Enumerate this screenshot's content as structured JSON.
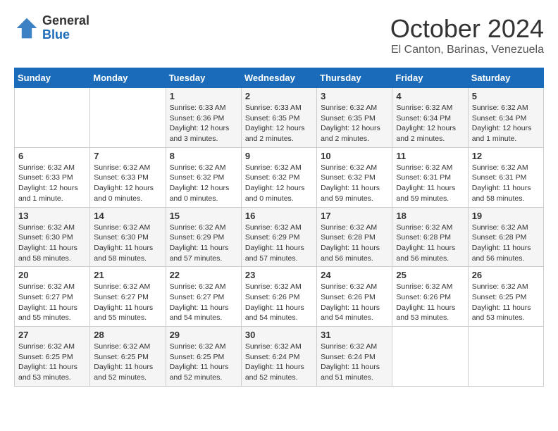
{
  "logo": {
    "general": "General",
    "blue": "Blue"
  },
  "header": {
    "month": "October 2024",
    "location": "El Canton, Barinas, Venezuela"
  },
  "weekdays": [
    "Sunday",
    "Monday",
    "Tuesday",
    "Wednesday",
    "Thursday",
    "Friday",
    "Saturday"
  ],
  "weeks": [
    [
      {
        "day": "",
        "info": ""
      },
      {
        "day": "",
        "info": ""
      },
      {
        "day": "1",
        "info": "Sunrise: 6:33 AM\nSunset: 6:36 PM\nDaylight: 12 hours and 3 minutes."
      },
      {
        "day": "2",
        "info": "Sunrise: 6:33 AM\nSunset: 6:35 PM\nDaylight: 12 hours and 2 minutes."
      },
      {
        "day": "3",
        "info": "Sunrise: 6:32 AM\nSunset: 6:35 PM\nDaylight: 12 hours and 2 minutes."
      },
      {
        "day": "4",
        "info": "Sunrise: 6:32 AM\nSunset: 6:34 PM\nDaylight: 12 hours and 2 minutes."
      },
      {
        "day": "5",
        "info": "Sunrise: 6:32 AM\nSunset: 6:34 PM\nDaylight: 12 hours and 1 minute."
      }
    ],
    [
      {
        "day": "6",
        "info": "Sunrise: 6:32 AM\nSunset: 6:33 PM\nDaylight: 12 hours and 1 minute."
      },
      {
        "day": "7",
        "info": "Sunrise: 6:32 AM\nSunset: 6:33 PM\nDaylight: 12 hours and 0 minutes."
      },
      {
        "day": "8",
        "info": "Sunrise: 6:32 AM\nSunset: 6:32 PM\nDaylight: 12 hours and 0 minutes."
      },
      {
        "day": "9",
        "info": "Sunrise: 6:32 AM\nSunset: 6:32 PM\nDaylight: 12 hours and 0 minutes."
      },
      {
        "day": "10",
        "info": "Sunrise: 6:32 AM\nSunset: 6:32 PM\nDaylight: 11 hours and 59 minutes."
      },
      {
        "day": "11",
        "info": "Sunrise: 6:32 AM\nSunset: 6:31 PM\nDaylight: 11 hours and 59 minutes."
      },
      {
        "day": "12",
        "info": "Sunrise: 6:32 AM\nSunset: 6:31 PM\nDaylight: 11 hours and 58 minutes."
      }
    ],
    [
      {
        "day": "13",
        "info": "Sunrise: 6:32 AM\nSunset: 6:30 PM\nDaylight: 11 hours and 58 minutes."
      },
      {
        "day": "14",
        "info": "Sunrise: 6:32 AM\nSunset: 6:30 PM\nDaylight: 11 hours and 58 minutes."
      },
      {
        "day": "15",
        "info": "Sunrise: 6:32 AM\nSunset: 6:29 PM\nDaylight: 11 hours and 57 minutes."
      },
      {
        "day": "16",
        "info": "Sunrise: 6:32 AM\nSunset: 6:29 PM\nDaylight: 11 hours and 57 minutes."
      },
      {
        "day": "17",
        "info": "Sunrise: 6:32 AM\nSunset: 6:28 PM\nDaylight: 11 hours and 56 minutes."
      },
      {
        "day": "18",
        "info": "Sunrise: 6:32 AM\nSunset: 6:28 PM\nDaylight: 11 hours and 56 minutes."
      },
      {
        "day": "19",
        "info": "Sunrise: 6:32 AM\nSunset: 6:28 PM\nDaylight: 11 hours and 56 minutes."
      }
    ],
    [
      {
        "day": "20",
        "info": "Sunrise: 6:32 AM\nSunset: 6:27 PM\nDaylight: 11 hours and 55 minutes."
      },
      {
        "day": "21",
        "info": "Sunrise: 6:32 AM\nSunset: 6:27 PM\nDaylight: 11 hours and 55 minutes."
      },
      {
        "day": "22",
        "info": "Sunrise: 6:32 AM\nSunset: 6:27 PM\nDaylight: 11 hours and 54 minutes."
      },
      {
        "day": "23",
        "info": "Sunrise: 6:32 AM\nSunset: 6:26 PM\nDaylight: 11 hours and 54 minutes."
      },
      {
        "day": "24",
        "info": "Sunrise: 6:32 AM\nSunset: 6:26 PM\nDaylight: 11 hours and 54 minutes."
      },
      {
        "day": "25",
        "info": "Sunrise: 6:32 AM\nSunset: 6:26 PM\nDaylight: 11 hours and 53 minutes."
      },
      {
        "day": "26",
        "info": "Sunrise: 6:32 AM\nSunset: 6:25 PM\nDaylight: 11 hours and 53 minutes."
      }
    ],
    [
      {
        "day": "27",
        "info": "Sunrise: 6:32 AM\nSunset: 6:25 PM\nDaylight: 11 hours and 53 minutes."
      },
      {
        "day": "28",
        "info": "Sunrise: 6:32 AM\nSunset: 6:25 PM\nDaylight: 11 hours and 52 minutes."
      },
      {
        "day": "29",
        "info": "Sunrise: 6:32 AM\nSunset: 6:25 PM\nDaylight: 11 hours and 52 minutes."
      },
      {
        "day": "30",
        "info": "Sunrise: 6:32 AM\nSunset: 6:24 PM\nDaylight: 11 hours and 52 minutes."
      },
      {
        "day": "31",
        "info": "Sunrise: 6:32 AM\nSunset: 6:24 PM\nDaylight: 11 hours and 51 minutes."
      },
      {
        "day": "",
        "info": ""
      },
      {
        "day": "",
        "info": ""
      }
    ]
  ]
}
